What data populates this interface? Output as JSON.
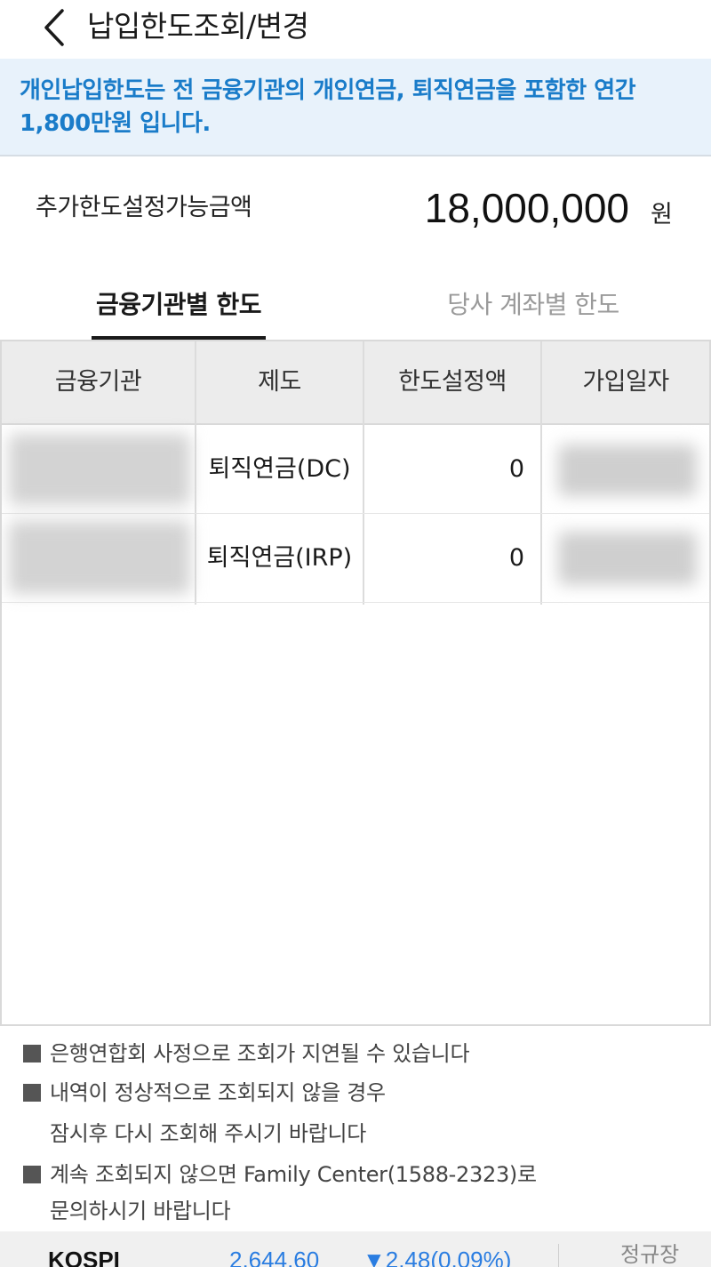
{
  "header": {
    "title": "납입한도조회/변경",
    "back_icon": "chevron-left-icon"
  },
  "notice": {
    "text": "개인납입한도는 전 금융기관의 개인연금, 퇴직연금을 포함한 연간 1,800만원 입니다.",
    "color": "#1a7cc9",
    "background": "#e8f2fb"
  },
  "limit": {
    "label": "추가한도설정가능금액",
    "amount": "18,000,000",
    "unit": "원"
  },
  "tabs": [
    {
      "label": "금융기관별 한도",
      "active": true
    },
    {
      "label": "당사 계좌별 한도",
      "active": false
    }
  ],
  "table": {
    "columns": [
      "금융기관",
      "제도",
      "한도설정액",
      "가입일자"
    ],
    "rows": [
      {
        "institution": "",
        "plan": "퇴직연금(DC)",
        "limit": "0",
        "join_date": ""
      },
      {
        "institution": "",
        "plan": "퇴직연금(IRP)",
        "limit": "0",
        "join_date": ""
      }
    ]
  },
  "footnotes": {
    "line1": "은행연합회 사정으로 조회가 지연될 수 있습니다",
    "line2": "내역이 정상적으로 조회되지 않을 경우",
    "line2_cont": "잠시후 다시 조회해 주시기 바랍니다",
    "line3": "계속 조회되지 않으면 Family Center(1588-2323)로",
    "line3_cont": "문의하시기 바랍니다"
  },
  "ticker": {
    "index_name": "KOSPI",
    "value": "2,644.60",
    "change": "▼2.48(0.09%)",
    "session": "정규장",
    "change_color": "#2a7de1"
  }
}
